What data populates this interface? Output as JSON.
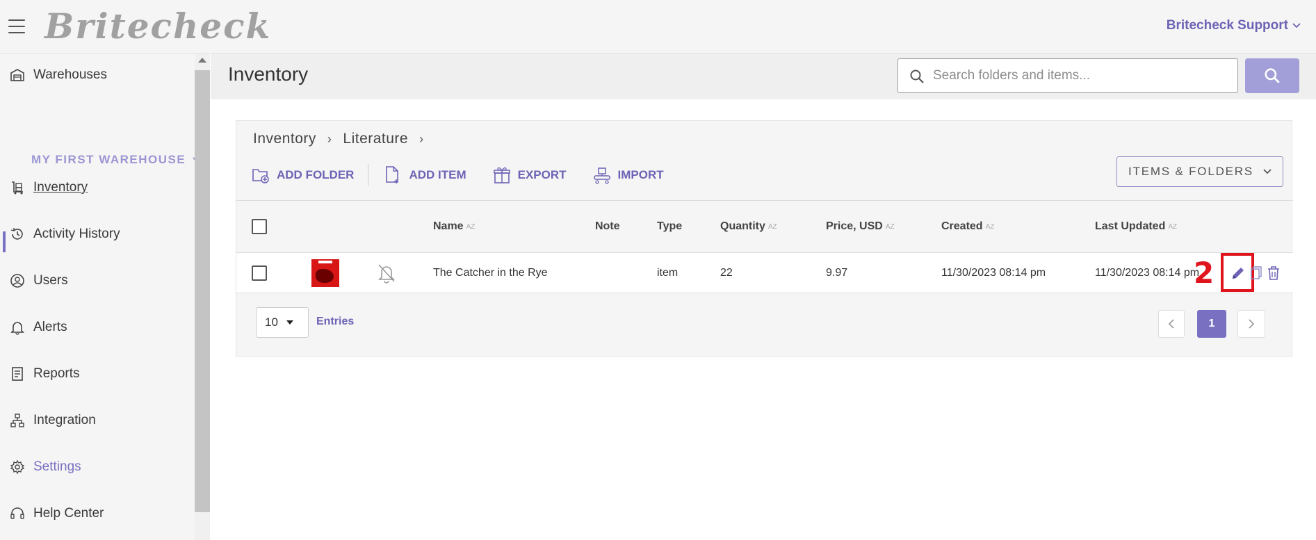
{
  "header": {
    "logo_text": "Britecheck",
    "user_menu": "Britecheck Support"
  },
  "sidebar": {
    "warehouses_label": "Warehouses",
    "warehouse_selected": "MY FIRST WAREHOUSE",
    "items": [
      {
        "label": "Inventory",
        "icon": "inventory-cart-icon",
        "active": true
      },
      {
        "label": "Activity History",
        "icon": "history-icon"
      },
      {
        "label": "Users",
        "icon": "user-icon"
      },
      {
        "label": "Alerts",
        "icon": "bell-icon"
      },
      {
        "label": "Reports",
        "icon": "report-icon"
      },
      {
        "label": "Integration",
        "icon": "network-icon"
      },
      {
        "label": "Settings",
        "icon": "gear-icon"
      },
      {
        "label": "Help Center",
        "icon": "help-icon"
      }
    ]
  },
  "page": {
    "title": "Inventory",
    "search_placeholder": "Search folders and items..."
  },
  "breadcrumb": [
    "Inventory",
    "Literature"
  ],
  "toolbar": {
    "add_folder": "ADD FOLDER",
    "add_item": "ADD ITEM",
    "export": "EXPORT",
    "import": "IMPORT",
    "view_selector": "ITEMS & FOLDERS"
  },
  "table": {
    "columns": {
      "name": "Name",
      "note": "Note",
      "type": "Type",
      "quantity": "Quantity",
      "price": "Price, USD",
      "created": "Created",
      "updated": "Last Updated"
    },
    "sort_glyph": "AZ",
    "rows": [
      {
        "name": "The Catcher in the Rye",
        "note": "",
        "type": "item",
        "quantity": "22",
        "price": "9.97",
        "created": "11/30/2023 08:14 pm",
        "updated": "11/30/2023 08:14 pm"
      }
    ]
  },
  "annotation": {
    "marker": "2",
    "color": "#e0141c"
  },
  "pagination": {
    "page_size": "10",
    "entries_label": "Entries",
    "current_page": "1"
  },
  "colors": {
    "accent": "#7a70c2",
    "search_button": "#a19ed8"
  }
}
